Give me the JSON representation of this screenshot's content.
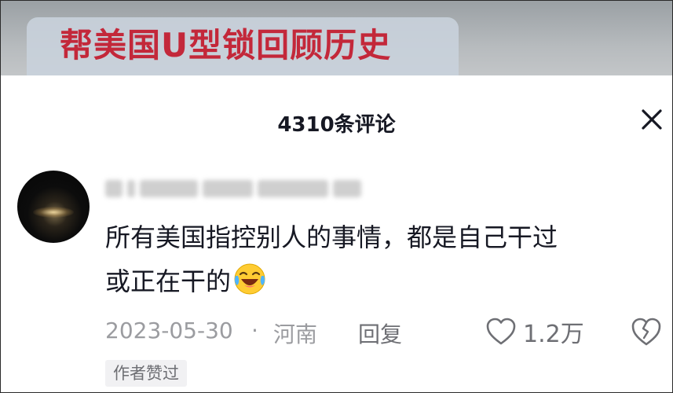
{
  "video": {
    "title": "帮美国U型锁回顾历史"
  },
  "comments_sheet": {
    "title": "4310条评论",
    "close_icon": "close-icon"
  },
  "comment": {
    "avatar": "avatar-dark-night",
    "username_redacted": true,
    "text_line1": "所有美国指控别人的事情，都是自己干过",
    "text_line2": "或正在干的",
    "emoji": "laughing-crying-emoji",
    "date": "2023-05-30",
    "separator": "·",
    "location": "河南",
    "reply_label": "回复",
    "like_icon": "heart-outline-icon",
    "like_count": "1.2万",
    "dislike_icon": "broken-heart-icon",
    "author_badge": "作者赞过"
  },
  "colors": {
    "title_red": "#c3283a",
    "text_primary": "#161823",
    "text_meta": "#9b9ca0",
    "text_secondary": "#6e6f74",
    "badge_bg": "#f1f1f3"
  }
}
